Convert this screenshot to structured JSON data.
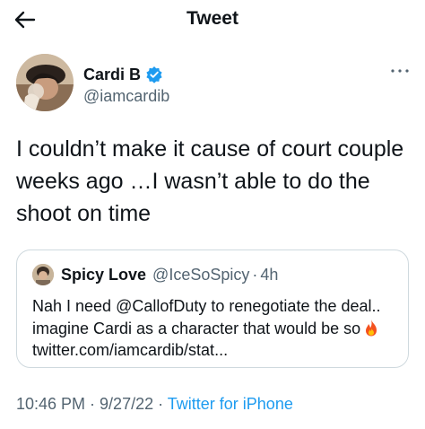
{
  "header": {
    "back_icon": "arrow-left-icon",
    "title": "Tweet"
  },
  "author": {
    "name": "Cardi B",
    "handle": "@iamcardib",
    "verified_icon": "verified-badge-icon",
    "more_icon": "more-horizontal-icon"
  },
  "tweet": {
    "text": "I couldn’t make it cause of court couple weeks ago …I wasn’t  able to do the shoot on time"
  },
  "quote": {
    "name": "Spicy Love",
    "handle": "@IceSoSpicy",
    "separator": "·",
    "time": "4h",
    "text": "Nah I need @CallofDuty to renegotiate the deal.. imagine Cardi as a character that would be so",
    "emoji_icon": "fire-icon",
    "link": "twitter.com/iamcardib/stat..."
  },
  "meta": {
    "time": "10:46 PM",
    "date": "9/27/22",
    "separator": " · ",
    "source": "Twitter for iPhone"
  },
  "colors": {
    "text": "#0f1419",
    "secondary": "#536471",
    "accent": "#1d9bf0",
    "border": "#cfd9de"
  }
}
